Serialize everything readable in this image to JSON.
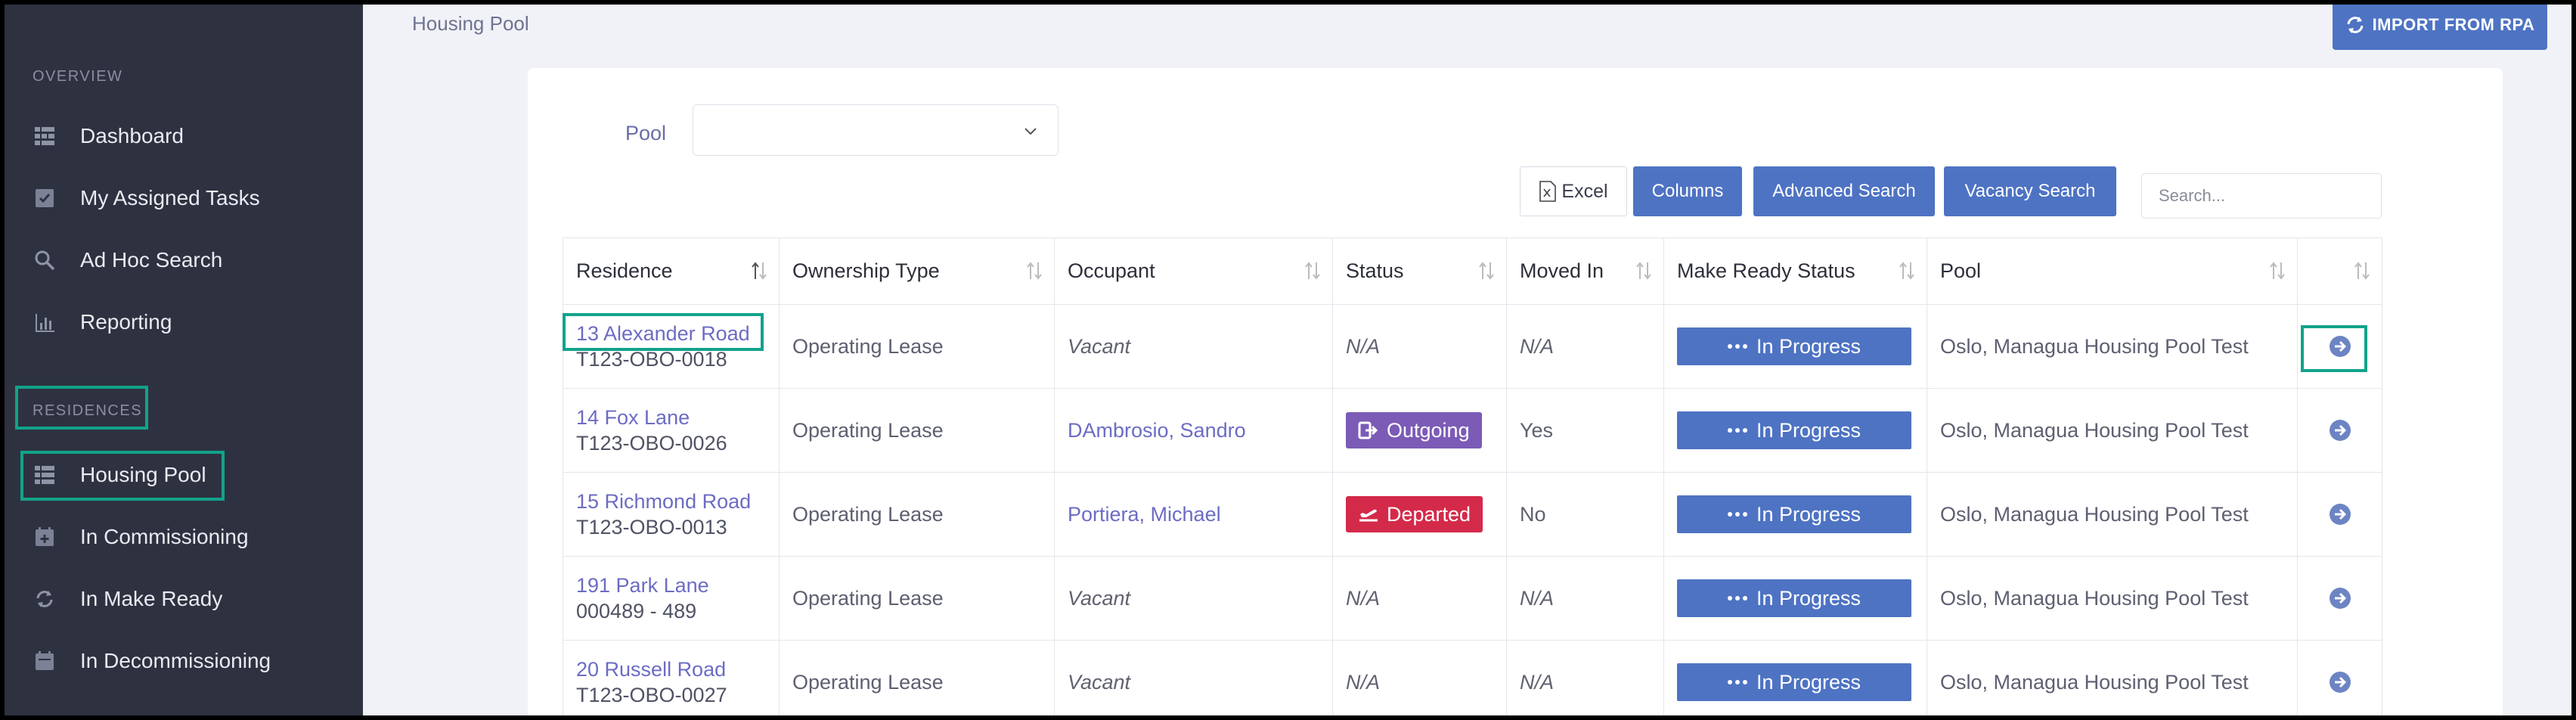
{
  "page": {
    "title": "Housing Pool"
  },
  "actions": {
    "import_label": "IMPORT FROM RPA"
  },
  "sidebar": {
    "sections": [
      {
        "label": "OVERVIEW"
      },
      {
        "label": "RESIDENCES"
      }
    ],
    "items": [
      {
        "label": "Dashboard",
        "icon": "dashboard-icon"
      },
      {
        "label": "My Assigned Tasks",
        "icon": "checkbox-icon"
      },
      {
        "label": "Ad Hoc Search",
        "icon": "search-icon"
      },
      {
        "label": "Reporting",
        "icon": "bar-chart-icon"
      },
      {
        "label": "Housing Pool",
        "icon": "list-icon",
        "active": true
      },
      {
        "label": "In Commissioning",
        "icon": "calendar-plus-icon"
      },
      {
        "label": "In Make Ready",
        "icon": "refresh-icon"
      },
      {
        "label": "In Decommissioning",
        "icon": "calendar-icon"
      }
    ]
  },
  "filters": {
    "pool_label": "Pool",
    "pool_value": "",
    "excel_label": "Excel",
    "columns_label": "Columns",
    "advanced_label": "Advanced Search",
    "vacancy_label": "Vacancy Search",
    "search_placeholder": "Search..."
  },
  "table": {
    "headers": [
      "Residence",
      "Ownership Type",
      "Occupant",
      "Status",
      "Moved In",
      "Make Ready Status",
      "Pool",
      ""
    ],
    "rows": [
      {
        "residence": "13 Alexander Road",
        "code": "T123-OBO-0018",
        "ownership": "Operating Lease",
        "occupant": "Vacant",
        "occupant_vacant": true,
        "status": "N/A",
        "moved_in": "N/A",
        "make_ready": "In Progress",
        "pool": "Oslo, Managua Housing Pool Test"
      },
      {
        "residence": "14 Fox Lane",
        "code": "T123-OBO-0026",
        "ownership": "Operating Lease",
        "occupant": "DAmbrosio, Sandro",
        "occupant_vacant": false,
        "status": "Outgoing",
        "moved_in": "Yes",
        "make_ready": "In Progress",
        "pool": "Oslo, Managua Housing Pool Test"
      },
      {
        "residence": "15 Richmond Road",
        "code": "T123-OBO-0013",
        "ownership": "Operating Lease",
        "occupant": "Portiera, Michael",
        "occupant_vacant": false,
        "status": "Departed",
        "moved_in": "No",
        "make_ready": "In Progress",
        "pool": "Oslo, Managua Housing Pool Test"
      },
      {
        "residence": "191 Park Lane",
        "code": "000489 - 489",
        "ownership": "Operating Lease",
        "occupant": "Vacant",
        "occupant_vacant": true,
        "status": "N/A",
        "moved_in": "N/A",
        "make_ready": "In Progress",
        "pool": "Oslo, Managua Housing Pool Test"
      },
      {
        "residence": "20 Russell Road",
        "code": "T123-OBO-0027",
        "ownership": "Operating Lease",
        "occupant": "Vacant",
        "occupant_vacant": true,
        "status": "N/A",
        "moved_in": "N/A",
        "make_ready": "In Progress",
        "pool": "Oslo, Managua Housing Pool Test"
      }
    ]
  },
  "colors": {
    "sidebar_bg": "#2e3240",
    "primary": "#4e73c3",
    "outgoing": "#7b5bb6",
    "departed": "#d42a4a",
    "highlight": "#12a38a",
    "link": "#6c6cc4"
  }
}
